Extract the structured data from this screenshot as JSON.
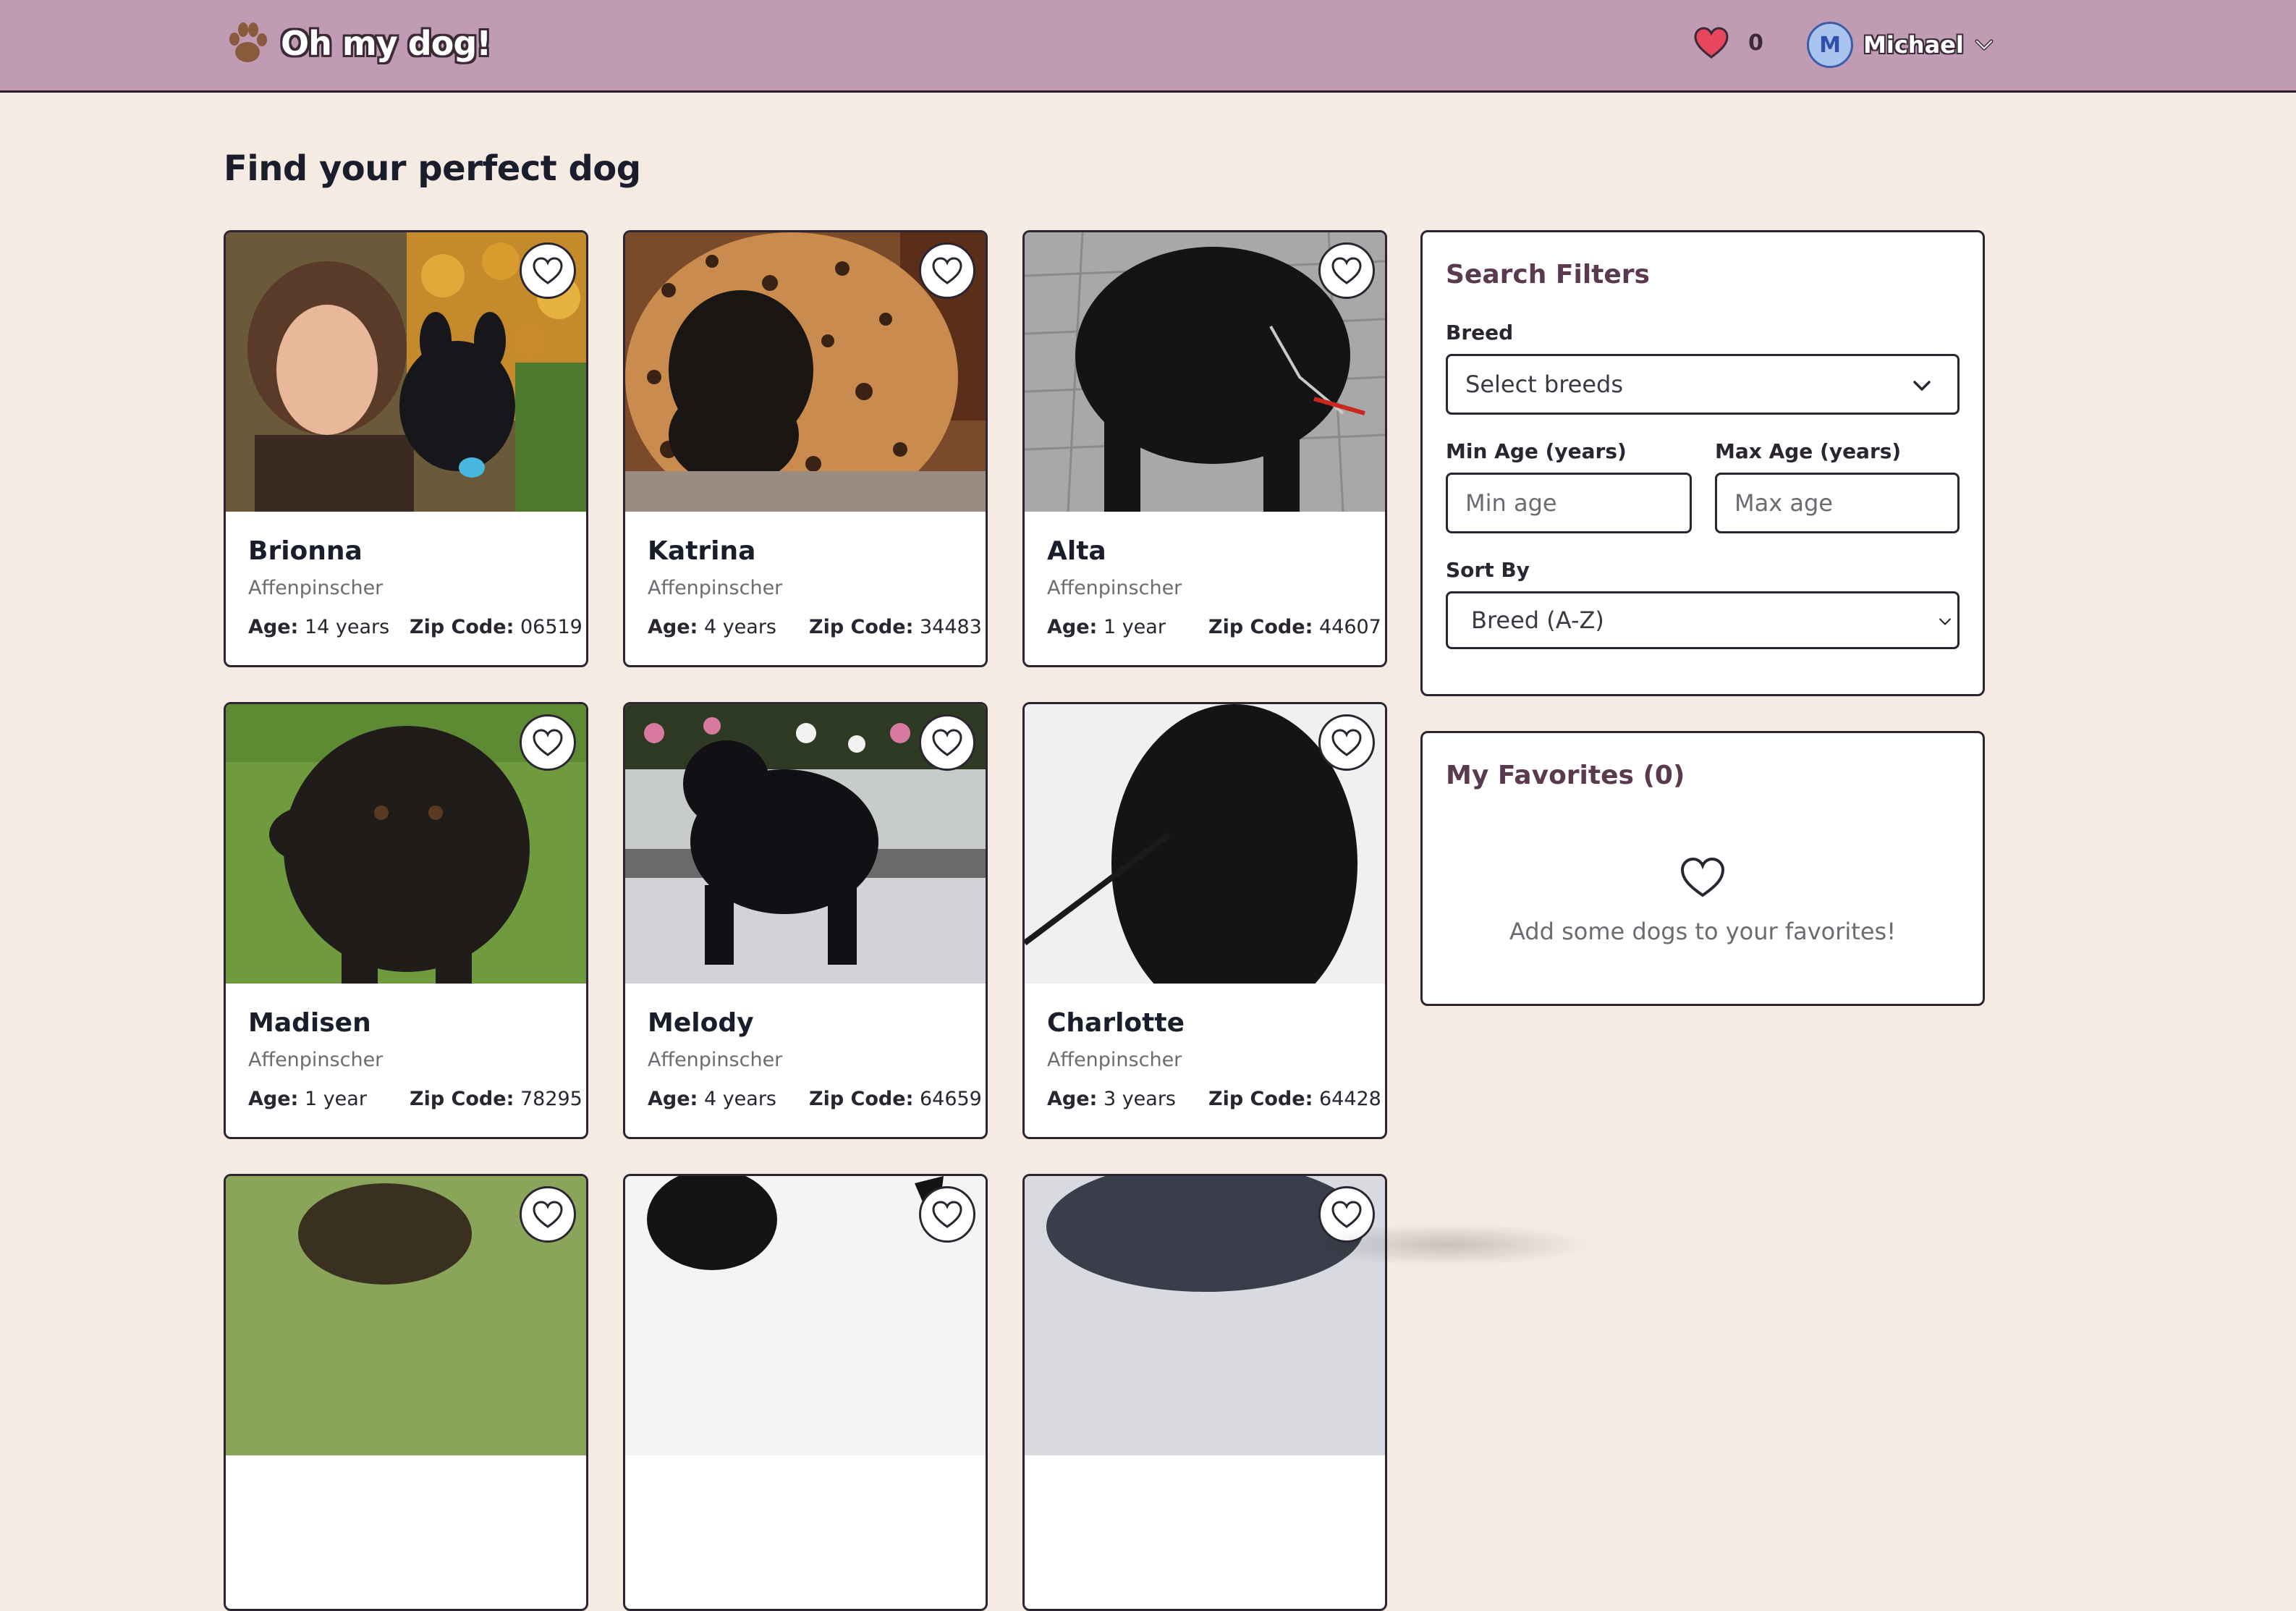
{
  "header": {
    "brand": "Oh my dog!",
    "favorites_count": "0",
    "user_initial": "M",
    "user_name": "Michael"
  },
  "page_title": "Find your perfect dog",
  "dogs": [
    {
      "name": "Brionna",
      "breed": "Affenpinscher",
      "age_label": "Age:",
      "age": "14 years",
      "zip_label": "Zip Code:",
      "zip": "06519"
    },
    {
      "name": "Katrina",
      "breed": "Affenpinscher",
      "age_label": "Age:",
      "age": "4 years",
      "zip_label": "Zip Code:",
      "zip": "34483"
    },
    {
      "name": "Alta",
      "breed": "Affenpinscher",
      "age_label": "Age:",
      "age": "1 year",
      "zip_label": "Zip Code:",
      "zip": "44607"
    },
    {
      "name": "Madisen",
      "breed": "Affenpinscher",
      "age_label": "Age:",
      "age": "1 year",
      "zip_label": "Zip Code:",
      "zip": "78295"
    },
    {
      "name": "Melody",
      "breed": "Affenpinscher",
      "age_label": "Age:",
      "age": "4 years",
      "zip_label": "Zip Code:",
      "zip": "64659"
    },
    {
      "name": "Charlotte",
      "breed": "Affenpinscher",
      "age_label": "Age:",
      "age": "3 years",
      "zip_label": "Zip Code:",
      "zip": "64428"
    }
  ],
  "filters": {
    "title": "Search Filters",
    "breed_label": "Breed",
    "breed_placeholder": "Select breeds",
    "min_age_label": "Min Age (years)",
    "min_age_placeholder": "Min age",
    "max_age_label": "Max Age (years)",
    "max_age_placeholder": "Max age",
    "sort_label": "Sort By",
    "sort_value": "Breed (A-Z)"
  },
  "favorites": {
    "title": "My Favorites (0)",
    "empty_text": "Add some dogs to your favorites!"
  },
  "colors": {
    "header_bg": "#bf9cb4",
    "page_bg": "#f5ebe3",
    "heart_red": "#e8455e",
    "panel_title": "#5a3a4e"
  }
}
